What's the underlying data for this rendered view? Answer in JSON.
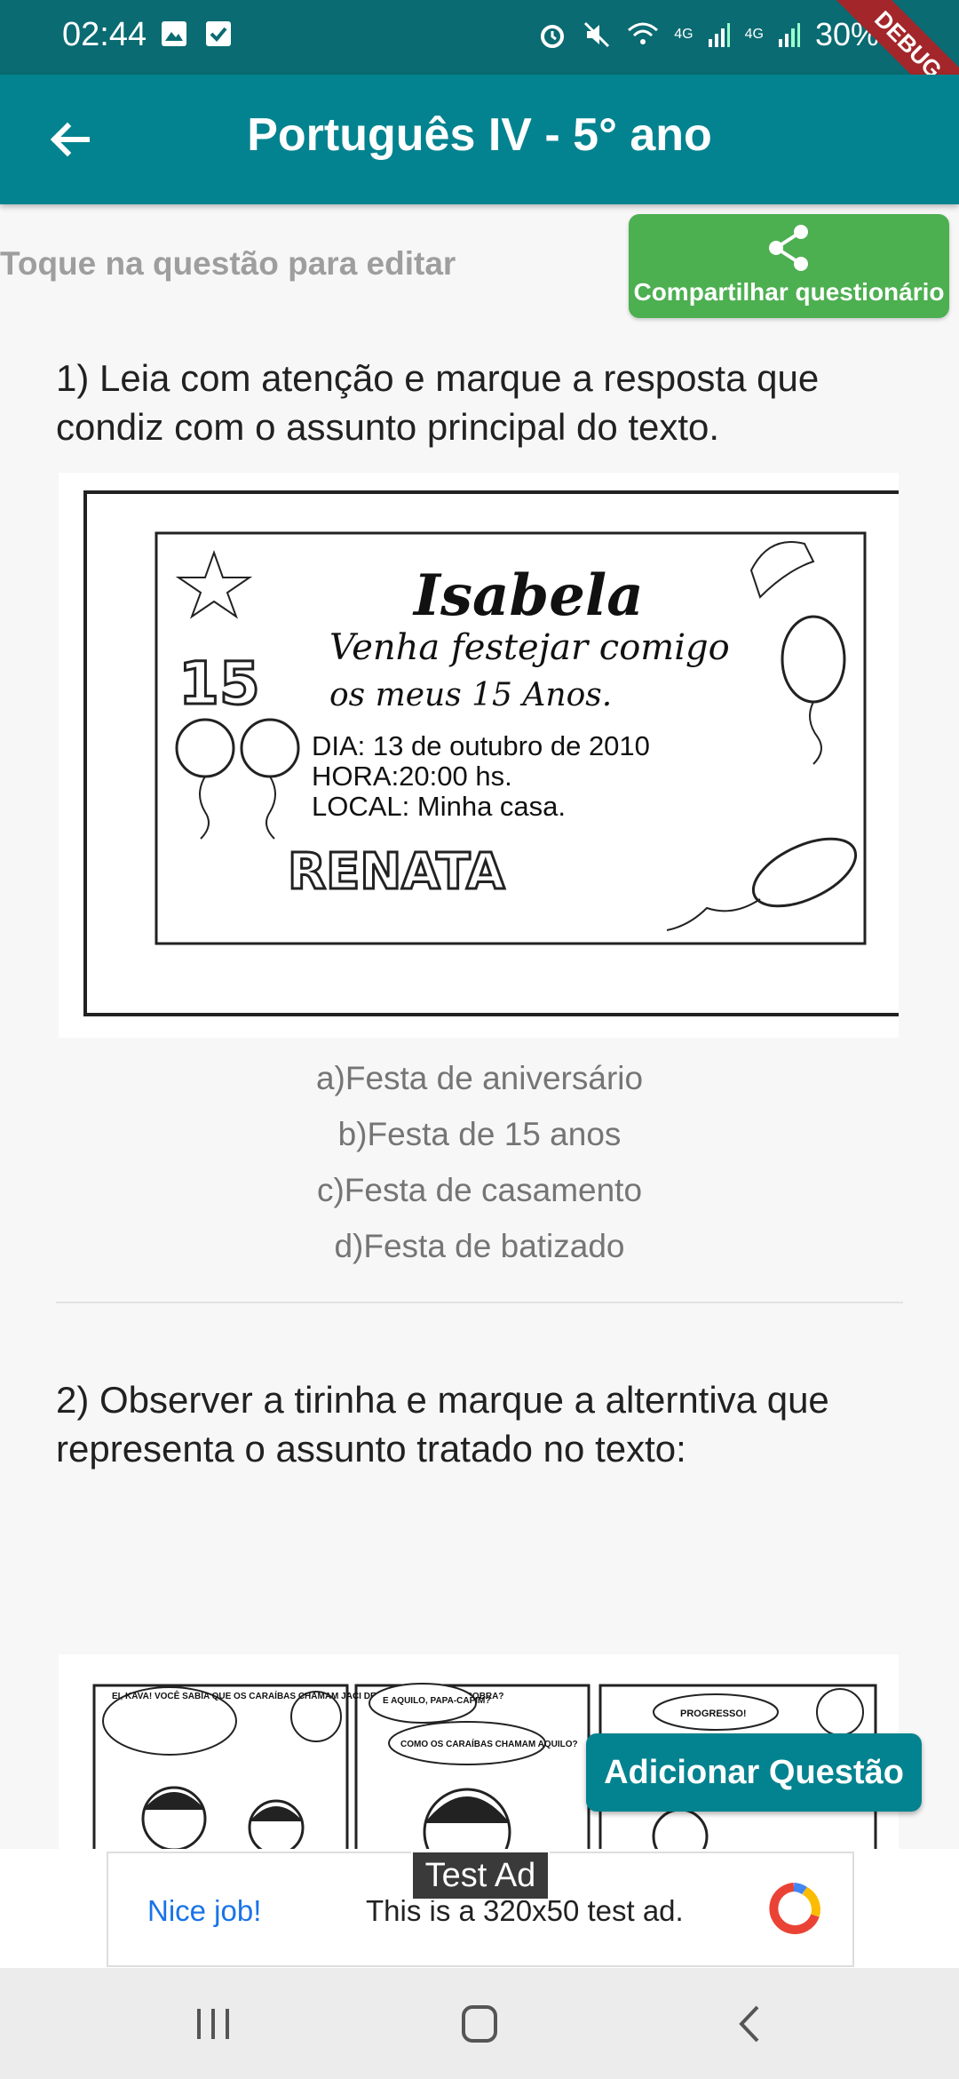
{
  "status": {
    "time": "02:44",
    "battery": "30%",
    "net1": "4G",
    "net2": "4G",
    "debug": "DEBUG"
  },
  "appbar": {
    "title": "Português IV - 5° ano"
  },
  "header": {
    "hint": "Toque na questão para editar",
    "share_label": "Compartilhar questionário"
  },
  "questions": [
    {
      "text": "1) Leia com atenção e marque a resposta que condiz com o assunto principal do texto.",
      "image": {
        "name": "Isabela",
        "line1": "Venha festejar comigo",
        "line2": "os meus 15 Anos.",
        "day": "DIA:  13 de outubro de 2010",
        "hour": "HORA:20:00 hs.",
        "place": "LOCAL: Minha casa.",
        "signature": "RENATA",
        "number": "15"
      },
      "options": [
        "a)Festa de aniversário",
        "b)Festa de 15 anos",
        "c)Festa de casamento",
        "d)Festa de batizado"
      ]
    },
    {
      "text": "2) Observer a tirinha e marque a alterntiva que representa o assunto tratado no texto:",
      "comic": {
        "bubble1": "EI, KAVA! VOCÊ SABIA QUE OS CARAÍBAS CHAMAM JACI DE LUA... E A M'BOI DE COBRA?",
        "bubble2a": "E AQUILO, PAPA-CAPIM?",
        "bubble2b": "COMO OS CARAÍBAS CHAMAM AQUILO?",
        "bubble3": "PROGRESSO!"
      }
    }
  ],
  "fab": {
    "label": "Adicionar Questão"
  },
  "ad": {
    "tag": "Test Ad",
    "nice": "Nice job!",
    "text": "This is a 320x50 test ad."
  },
  "icons": {
    "back": "arrow-back-icon",
    "share": "share-icon",
    "nav_recent": "recent-apps-icon",
    "nav_home": "home-icon",
    "nav_back": "nav-back-icon"
  },
  "colors": {
    "status_bar": "#0a6b72",
    "app_bar": "#03838f",
    "share_button": "#4caf50",
    "debug_banner": "#a3262a"
  }
}
